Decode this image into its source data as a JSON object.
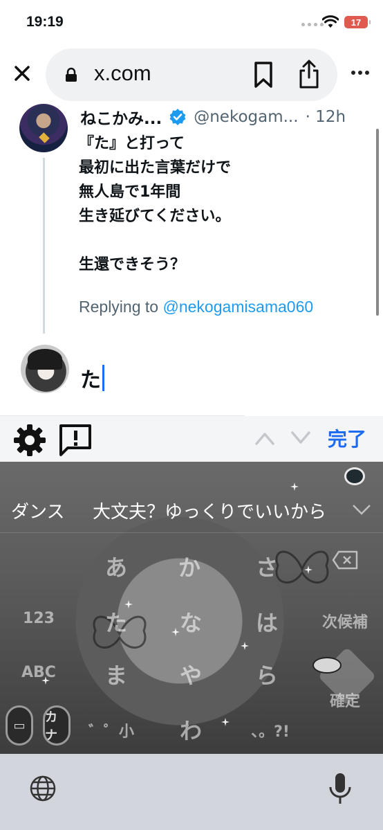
{
  "status_bar": {
    "time": "19:19",
    "battery": "17"
  },
  "browser": {
    "url": "x.com"
  },
  "tweet": {
    "name": "ねこかみ...",
    "handle": "@nekogam...",
    "time": "· 12h",
    "lines": [
      "『た』と打って",
      "最初に出た言葉だけで",
      "無人島で1年間",
      "生き延びてください。",
      "",
      "生還できそう？"
    ],
    "replying_prefix": "Replying to",
    "replying_to": "@nekogamisama060"
  },
  "compose": {
    "text": "た"
  },
  "accessory": {
    "done_label": "完了"
  },
  "keyboard": {
    "candidates": [
      "ダンス",
      "大文夫？ゆっくりでいいから"
    ],
    "keys": {
      "a": "あ",
      "ka": "か",
      "sa": "さ",
      "ta": "た",
      "na": "な",
      "ha": "は",
      "ma": "ま",
      "ya": "や",
      "ra": "ら",
      "wa": "わ",
      "dakuten": "゛゜小",
      "punct": "、。?!",
      "num": "123",
      "next_candidate": "次候補",
      "abc": "ABC",
      "confirm": "確定",
      "kana_mode": "カナ"
    }
  }
}
